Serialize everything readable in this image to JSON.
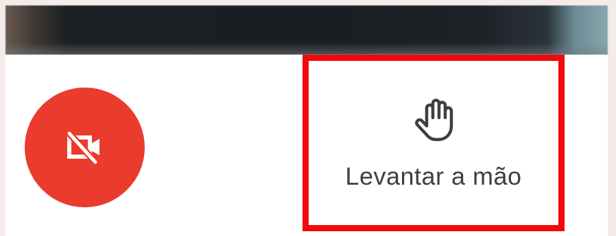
{
  "toolbar": {
    "camera_button": {
      "icon": "video-off-icon",
      "state": "off",
      "color": "#ea3b2c",
      "icon_color": "#ffffff"
    },
    "raise_hand": {
      "label": "Levantar a mão",
      "icon": "hand-icon",
      "highlight_color": "#f00a0a",
      "text_color": "#3c4043"
    }
  }
}
